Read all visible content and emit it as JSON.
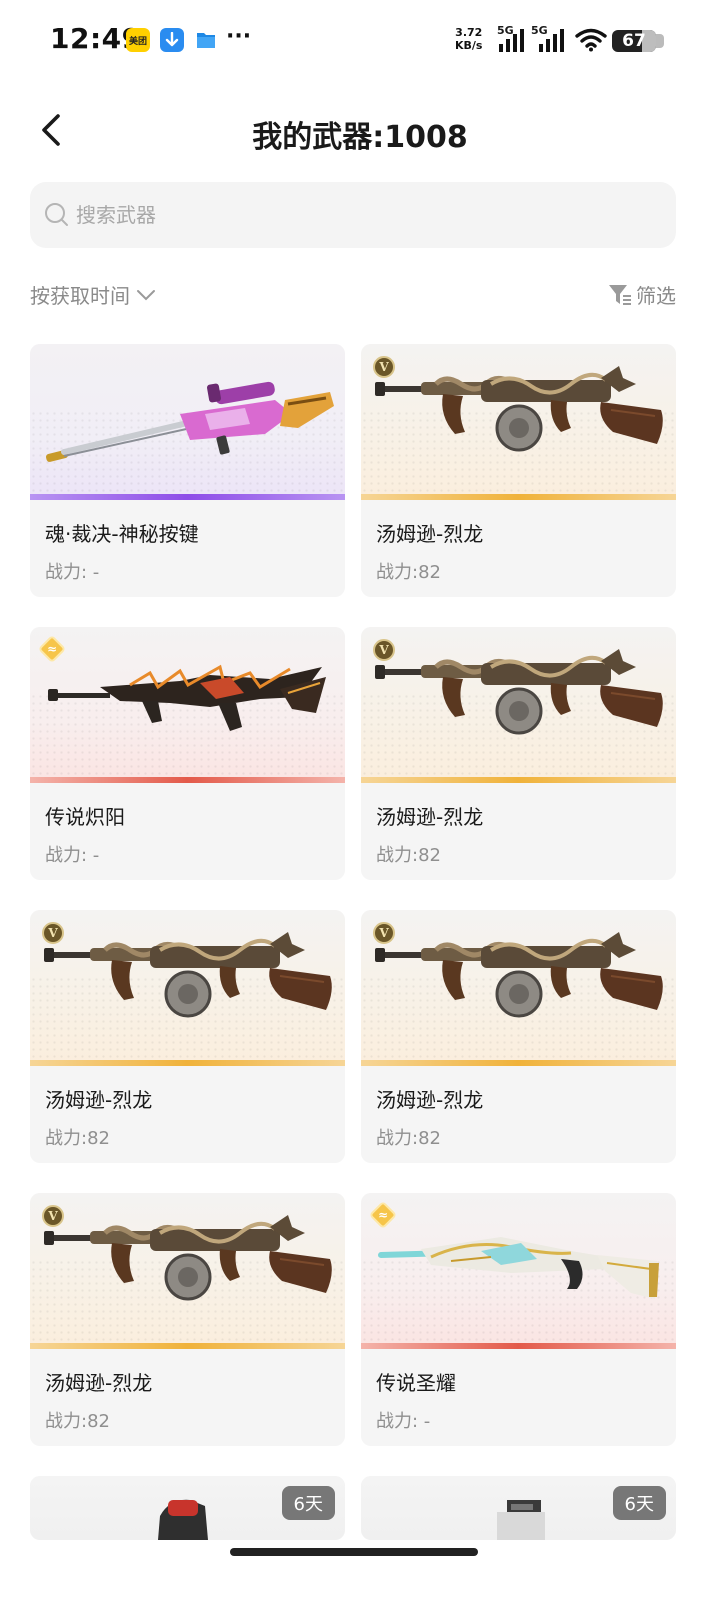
{
  "status_bar": {
    "time": "12:49",
    "apps": [
      "美团",
      "download-icon",
      "files-icon"
    ],
    "more": "···",
    "net_speed_value": "3.72",
    "net_speed_unit": "KB/s",
    "sim1": "5G",
    "sim2": "5G",
    "battery": "67"
  },
  "header": {
    "title": "我的武器:1008"
  },
  "search": {
    "placeholder": "搜索武器"
  },
  "toolbar": {
    "sort_label": "按获取时间",
    "filter_label": "筛选"
  },
  "colors": {
    "purple": "#8e4de8",
    "gold": "#f0b23a",
    "red": "#e35a4a"
  },
  "weapons": [
    {
      "name": "魂·裁决-神秘按键",
      "power": "战力: -",
      "rarity": "purple",
      "badge": "",
      "art": "sniper-pink"
    },
    {
      "name": "汤姆逊-烈龙",
      "power": "战力:82",
      "rarity": "gold",
      "badge": "V",
      "art": "tommy"
    },
    {
      "name": "传说炽阳",
      "power": "战力: -",
      "rarity": "red",
      "badge": "legend",
      "art": "rifle-fire"
    },
    {
      "name": "汤姆逊-烈龙",
      "power": "战力:82",
      "rarity": "gold",
      "badge": "V",
      "art": "tommy"
    },
    {
      "name": "汤姆逊-烈龙",
      "power": "战力:82",
      "rarity": "gold",
      "badge": "V",
      "art": "tommy"
    },
    {
      "name": "汤姆逊-烈龙",
      "power": "战力:82",
      "rarity": "gold",
      "badge": "V",
      "art": "tommy"
    },
    {
      "name": "汤姆逊-烈龙",
      "power": "战力:82",
      "rarity": "gold",
      "badge": "V",
      "art": "tommy"
    },
    {
      "name": "传说圣耀",
      "power": "战力: -",
      "rarity": "red",
      "badge": "legend",
      "art": "rifle-white"
    }
  ],
  "partial_cards": [
    {
      "days": "6天"
    },
    {
      "days": "6天"
    }
  ]
}
